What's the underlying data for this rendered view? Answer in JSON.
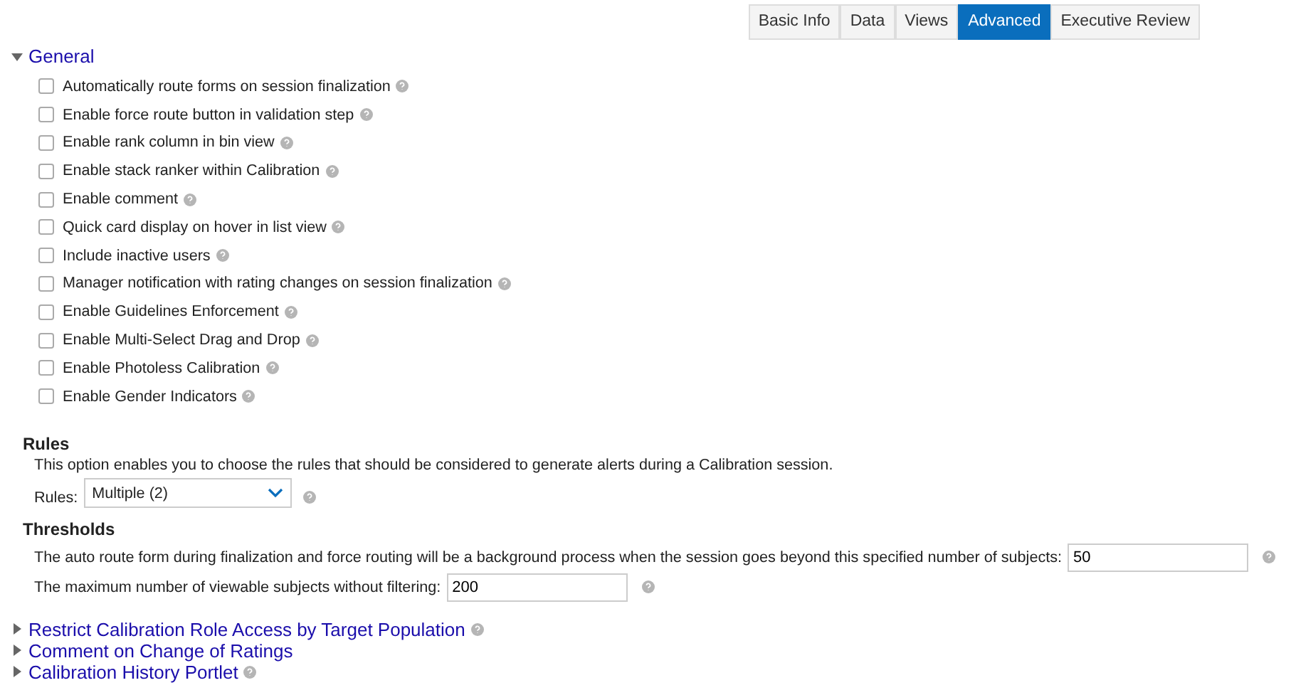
{
  "tabs": [
    {
      "label": "Basic Info",
      "selected": false
    },
    {
      "label": "Data",
      "selected": false
    },
    {
      "label": "Views",
      "selected": false
    },
    {
      "label": "Advanced",
      "selected": true
    },
    {
      "label": "Executive Review",
      "selected": false
    }
  ],
  "general": {
    "title": "General",
    "expanded": true,
    "options": [
      {
        "label": "Automatically route forms on session finalization",
        "checked": false
      },
      {
        "label": "Enable force route button in validation step",
        "checked": false
      },
      {
        "label": "Enable rank column in bin view",
        "checked": false
      },
      {
        "label": "Enable stack ranker within Calibration",
        "checked": false
      },
      {
        "label": "Enable comment",
        "checked": false
      },
      {
        "label": "Quick card display on hover in list view",
        "checked": false
      },
      {
        "label": "Include inactive users",
        "checked": false
      },
      {
        "label": "Manager notification with rating changes on session finalization",
        "checked": false
      },
      {
        "label": "Enable Guidelines Enforcement",
        "checked": false
      },
      {
        "label": "Enable Multi-Select Drag and Drop",
        "checked": false
      },
      {
        "label": "Enable Photoless Calibration",
        "checked": false
      },
      {
        "label": "Enable Gender Indicators",
        "checked": false
      }
    ]
  },
  "rules": {
    "title": "Rules",
    "description": "This option enables you to choose the rules that should be considered to generate alerts during a Calibration session.",
    "label": "Rules:",
    "value": "Multiple (2)"
  },
  "thresholds": {
    "title": "Thresholds",
    "fields": [
      {
        "label": "The auto route form during finalization and force routing will be a background process when the session goes beyond this specified number of subjects:",
        "value": "50"
      },
      {
        "label": "The maximum number of viewable subjects without filtering:",
        "value": "200"
      }
    ]
  },
  "sections": [
    {
      "title": "Restrict Calibration Role Access by Target Population",
      "expanded": false,
      "help": true
    },
    {
      "title": "Comment on Change of Ratings",
      "expanded": false,
      "help": false
    },
    {
      "title": "Calibration History Portlet",
      "expanded": false,
      "help": true
    }
  ]
}
